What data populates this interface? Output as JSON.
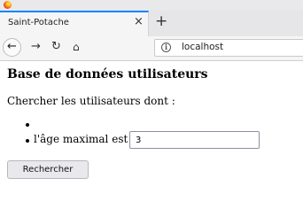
{
  "browser": {
    "tab": {
      "title": "Saint-Potache",
      "close_glyph": "×"
    },
    "new_tab_glyph": "+",
    "nav": {
      "back_icon": "arrow-left-icon",
      "forward_icon": "arrow-right-icon",
      "reload_icon": "reload-icon",
      "home_icon": "home-icon"
    },
    "url": "localhost",
    "accent_color": "#0a84ff"
  },
  "page": {
    "title": "Base de données utilisateurs",
    "intro": "Chercher les utilisateurs dont :",
    "criteria": [
      {
        "label": ""
      },
      {
        "label": "l'âge maximal est",
        "value": "3"
      }
    ],
    "submit_label": "Rechercher"
  }
}
